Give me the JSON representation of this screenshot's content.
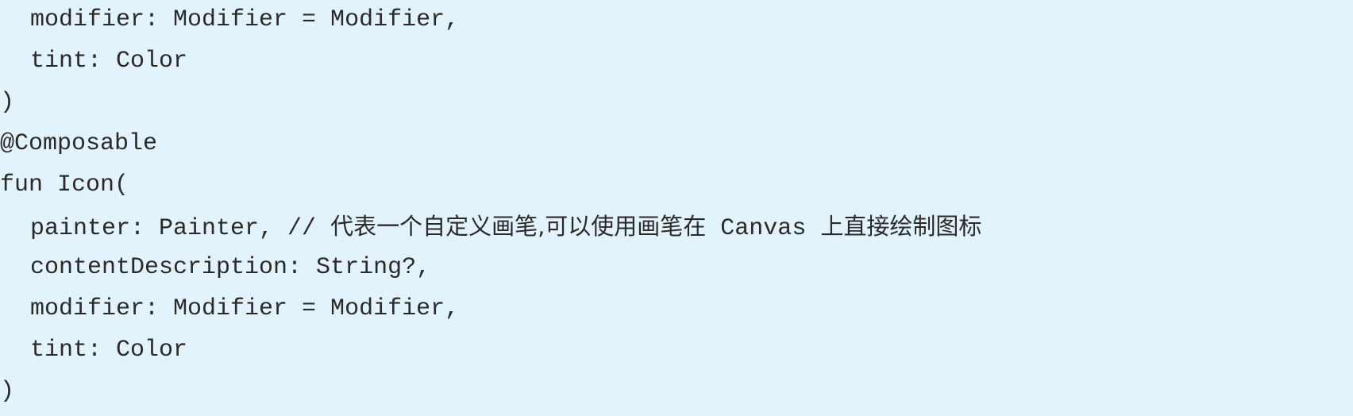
{
  "code": {
    "lines": [
      "modifier: Modifier = Modifier,",
      "tint: Color",
      ")",
      "@Composable",
      "fun Icon(",
      "painter: Painter, // ",
      "contentDescription: String?,",
      "modifier: Modifier = Modifier,",
      "tint: Color",
      ")"
    ],
    "comment_zh": "代表一个自定义画笔,可以使用画笔在",
    "comment_mid": " Canvas ",
    "comment_zh_end": "上直接绘制图标"
  }
}
